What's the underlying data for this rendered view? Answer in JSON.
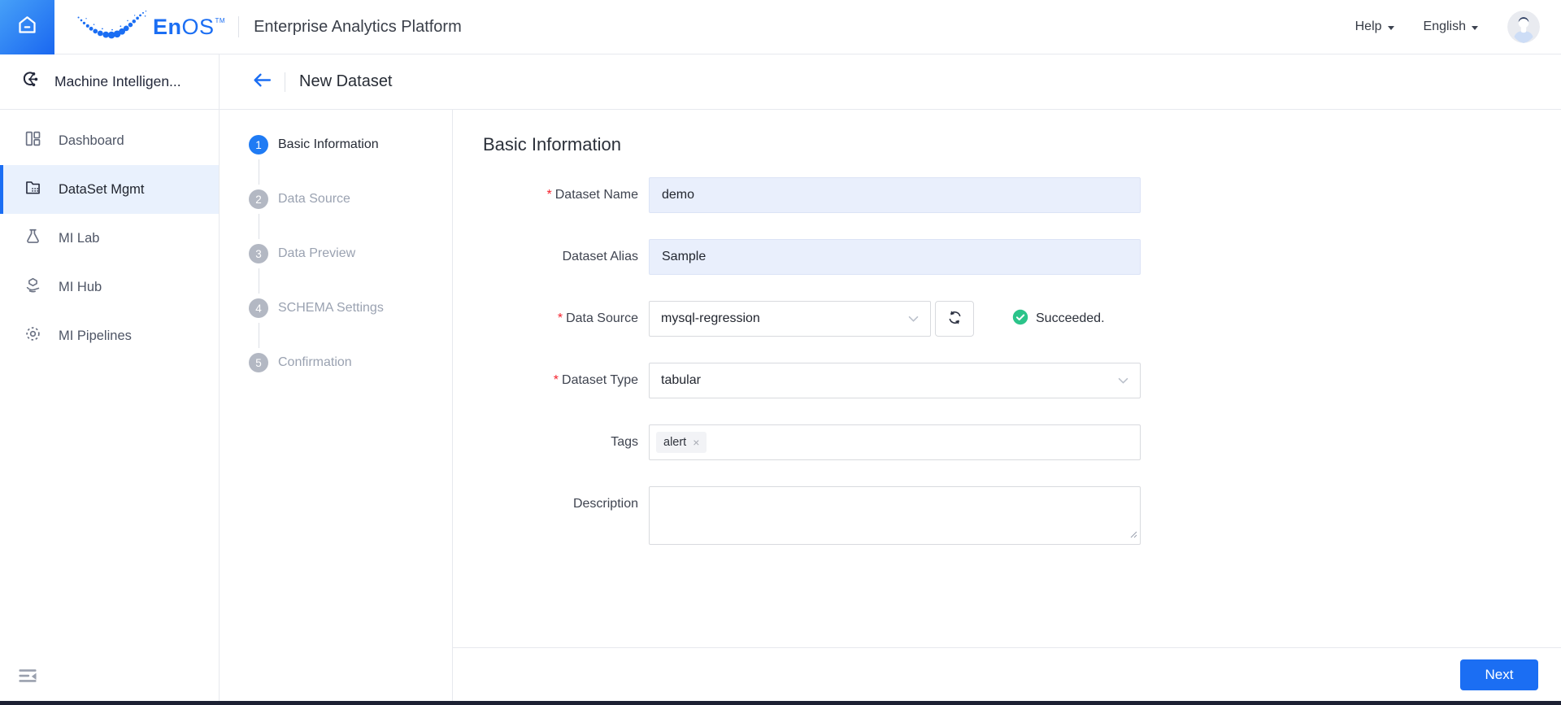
{
  "header": {
    "logo": {
      "en": "En",
      "os": "OS",
      "tm": "TM"
    },
    "platform_title": "Enterprise Analytics Platform",
    "help_label": "Help",
    "language_label": "English"
  },
  "sidebar": {
    "app_title": "Machine Intelligen...",
    "items": [
      {
        "label": "Dashboard",
        "icon": "dashboard-icon",
        "active": false
      },
      {
        "label": "DataSet Mgmt",
        "icon": "dataset-mgmt-icon",
        "active": true
      },
      {
        "label": "MI Lab",
        "icon": "mi-lab-icon",
        "active": false
      },
      {
        "label": "MI Hub",
        "icon": "mi-hub-icon",
        "active": false
      },
      {
        "label": "MI Pipelines",
        "icon": "mi-pipelines-icon",
        "active": false
      }
    ]
  },
  "page": {
    "title": "New Dataset"
  },
  "wizard": {
    "steps": [
      {
        "number": "1",
        "label": "Basic Information",
        "active": true
      },
      {
        "number": "2",
        "label": "Data Source",
        "active": false
      },
      {
        "number": "3",
        "label": "Data Preview",
        "active": false
      },
      {
        "number": "4",
        "label": "SCHEMA Settings",
        "active": false
      },
      {
        "number": "5",
        "label": "Confirmation",
        "active": false
      }
    ]
  },
  "form": {
    "section_title": "Basic Information",
    "required_marker": "*",
    "fields": {
      "dataset_name": {
        "label": "Dataset Name",
        "required": true,
        "value": "demo"
      },
      "dataset_alias": {
        "label": "Dataset Alias",
        "required": false,
        "value": "Sample"
      },
      "data_source": {
        "label": "Data Source",
        "required": true,
        "selected": "mysql-regression",
        "status_text": "Succeeded."
      },
      "dataset_type": {
        "label": "Dataset Type",
        "required": true,
        "selected": "tabular"
      },
      "tags": {
        "label": "Tags",
        "required": false,
        "chips": [
          "alert"
        ],
        "remove_glyph": "×"
      },
      "description": {
        "label": "Description",
        "required": false,
        "value": ""
      }
    },
    "next_label": "Next"
  },
  "colors": {
    "accent_blue": "#1B6EF3",
    "active_step_blue": "#1F7BF4",
    "success_green": "#2BC48A",
    "filled_input_bg": "#E9EFFC",
    "selected_nav_bg": "#E9F1FD"
  }
}
